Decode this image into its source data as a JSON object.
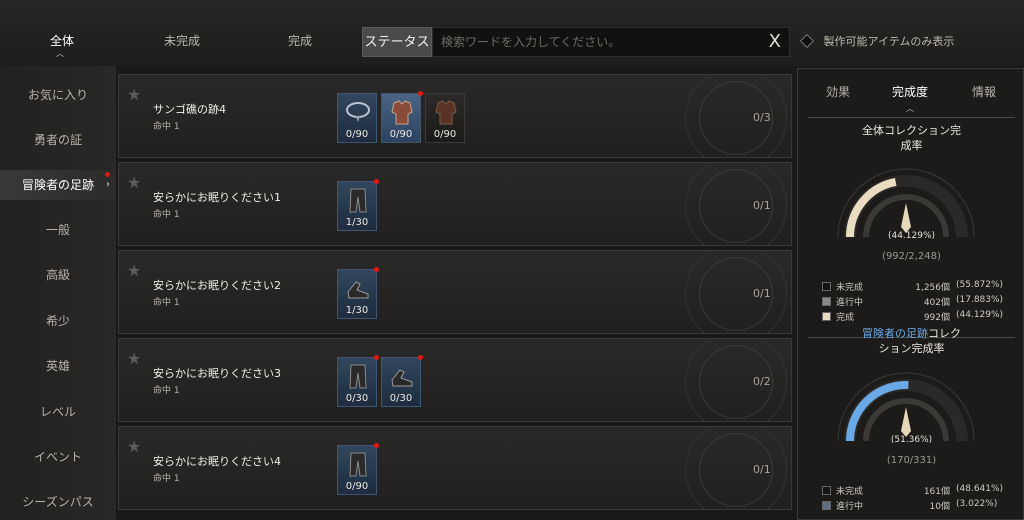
{
  "tabs": [
    "全体",
    "未完成",
    "完成"
  ],
  "status_button": "ステータス",
  "search": {
    "placeholder": "検索ワードを入力してください。",
    "clear": "X"
  },
  "filter_label": "製作可能アイテムのみ表示",
  "sidebar": [
    "お気に入り",
    "勇者の証",
    "冒険者の足跡",
    "一般",
    "高級",
    "希少",
    "英雄",
    "レベル",
    "イベント",
    "シーズンパス"
  ],
  "rows": [
    {
      "title": "サンゴ礁の跡4",
      "sub": "命中 1",
      "count": "0/3",
      "items": [
        {
          "qty": "0/90",
          "icon": "necklace-icon"
        },
        {
          "qty": "0/90",
          "icon": "armor-icon"
        },
        {
          "qty": "0/90",
          "icon": "armor-icon"
        }
      ]
    },
    {
      "title": "安らかにお眠りください1",
      "sub": "命中 1",
      "count": "0/1",
      "items": [
        {
          "qty": "1/30",
          "icon": "pants-icon"
        }
      ]
    },
    {
      "title": "安らかにお眠りください2",
      "sub": "命中 1",
      "count": "0/1",
      "items": [
        {
          "qty": "1/30",
          "icon": "boots-icon"
        }
      ]
    },
    {
      "title": "安らかにお眠りください3",
      "sub": "命中 1",
      "count": "0/2",
      "items": [
        {
          "qty": "0/30",
          "icon": "pants-icon"
        },
        {
          "qty": "0/30",
          "icon": "boots-icon"
        }
      ]
    },
    {
      "title": "安らかにお眠りください4",
      "sub": "命中 1",
      "count": "0/1",
      "items": [
        {
          "qty": "0/90",
          "icon": "pants-icon"
        }
      ]
    }
  ],
  "panel": {
    "tabs": [
      "効果",
      "完成度",
      "情報"
    ],
    "overall": {
      "title1": "全体コレクション完",
      "title2": "成率",
      "percent": "(44.129%)",
      "fraction": "(992/2,248)",
      "legend": [
        {
          "label": "未完成",
          "count": "1,256個",
          "pct": "(55.872%)",
          "color": "#141414"
        },
        {
          "label": "進行中",
          "count": "402個",
          "pct": "(17.883%)",
          "color": "#8a8784"
        },
        {
          "label": "完成",
          "count": "992個",
          "pct": "(44.129%)",
          "color": "#e9dcc0"
        }
      ],
      "accent": "#e9dcc0",
      "complete_fraction": 0.44129
    },
    "category": {
      "title_hl": "冒険者の足跡",
      "title_rest": "コレク",
      "title2": "ション完成率",
      "percent": "(51.36%)",
      "fraction": "(170/331)",
      "legend": [
        {
          "label": "未完成",
          "count": "161個",
          "pct": "(48.641%)",
          "color": "#141414"
        },
        {
          "label": "進行中",
          "count": "10個",
          "pct": "(3.022%)",
          "color": "#5f6f82"
        }
      ],
      "accent": "#6aa8e6",
      "complete_fraction": 0.5136
    }
  }
}
